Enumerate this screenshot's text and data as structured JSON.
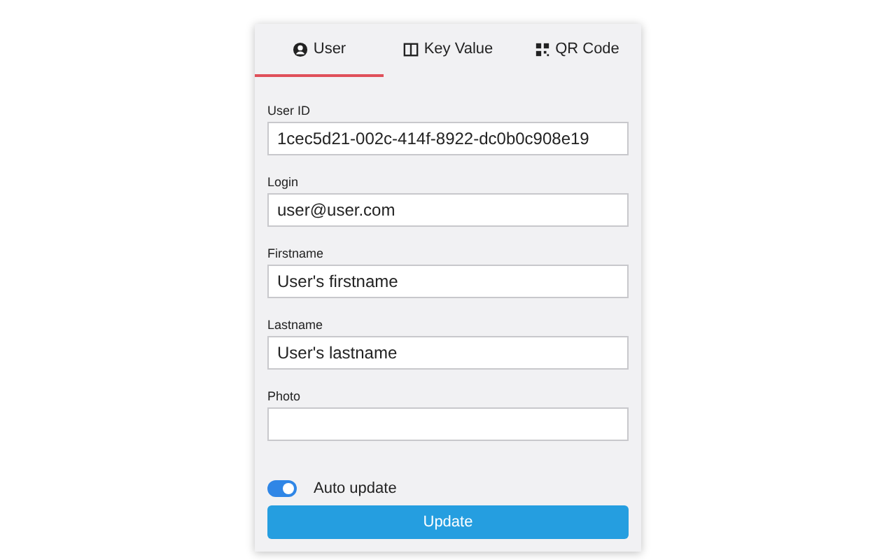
{
  "tabs": [
    {
      "label": "User",
      "selected": true
    },
    {
      "label": "Key Value",
      "selected": false
    },
    {
      "label": "QR Code",
      "selected": false
    }
  ],
  "fields": [
    {
      "label": "User ID",
      "value": "1cec5d21-002c-414f-8922-dc0b0c908e19"
    },
    {
      "label": "Login",
      "value": "user@user.com"
    },
    {
      "label": "Firstname",
      "value": "User's firstname"
    },
    {
      "label": "Lastname",
      "value": "User's lastname"
    },
    {
      "label": "Photo"
    }
  ],
  "auto_update": {
    "label": "Auto update",
    "on": true
  },
  "button": "Update"
}
